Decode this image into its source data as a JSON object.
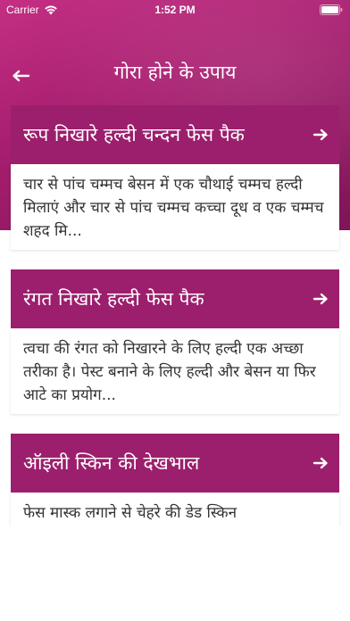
{
  "status_bar": {
    "carrier": "Carrier",
    "time": "1:52 PM",
    "wifi_icon": "wifi-icon",
    "battery_icon": "battery-icon"
  },
  "nav": {
    "title": "गोरा होने के उपाय",
    "back_icon": "back-arrow-icon"
  },
  "colors": {
    "header_gradient_start": "#c42f83",
    "header_gradient_end": "#7d1657",
    "card_header": "#9c1f6d",
    "body_text": "#333333"
  },
  "cards": [
    {
      "title": "रूप निखारे हल्दी चन्दन फेस पैक",
      "body": "चार से पांच चम्मच बेसन में एक चौथाई चम्मच हल्दी मिलाएं और चार से पांच चम्मच कच्चा दूध व एक चम्मच शहद मि...",
      "icon": "arrow-right-icon"
    },
    {
      "title": "रंगत निखारे हल्दी फेस पैक",
      "body": "त्वचा की रंगत को निखारने के लिए हल्दी एक अच्छा तरीका है। पेस्ट बनाने के लिए हल्दी और बेसन या फिर आटे का प्रयोग...",
      "icon": "arrow-right-icon"
    },
    {
      "title": "ऑइली स्किन की देखभाल",
      "body": "फेस मास्क लगाने से चेहरे की डेड स्किन",
      "icon": "arrow-right-icon"
    }
  ]
}
